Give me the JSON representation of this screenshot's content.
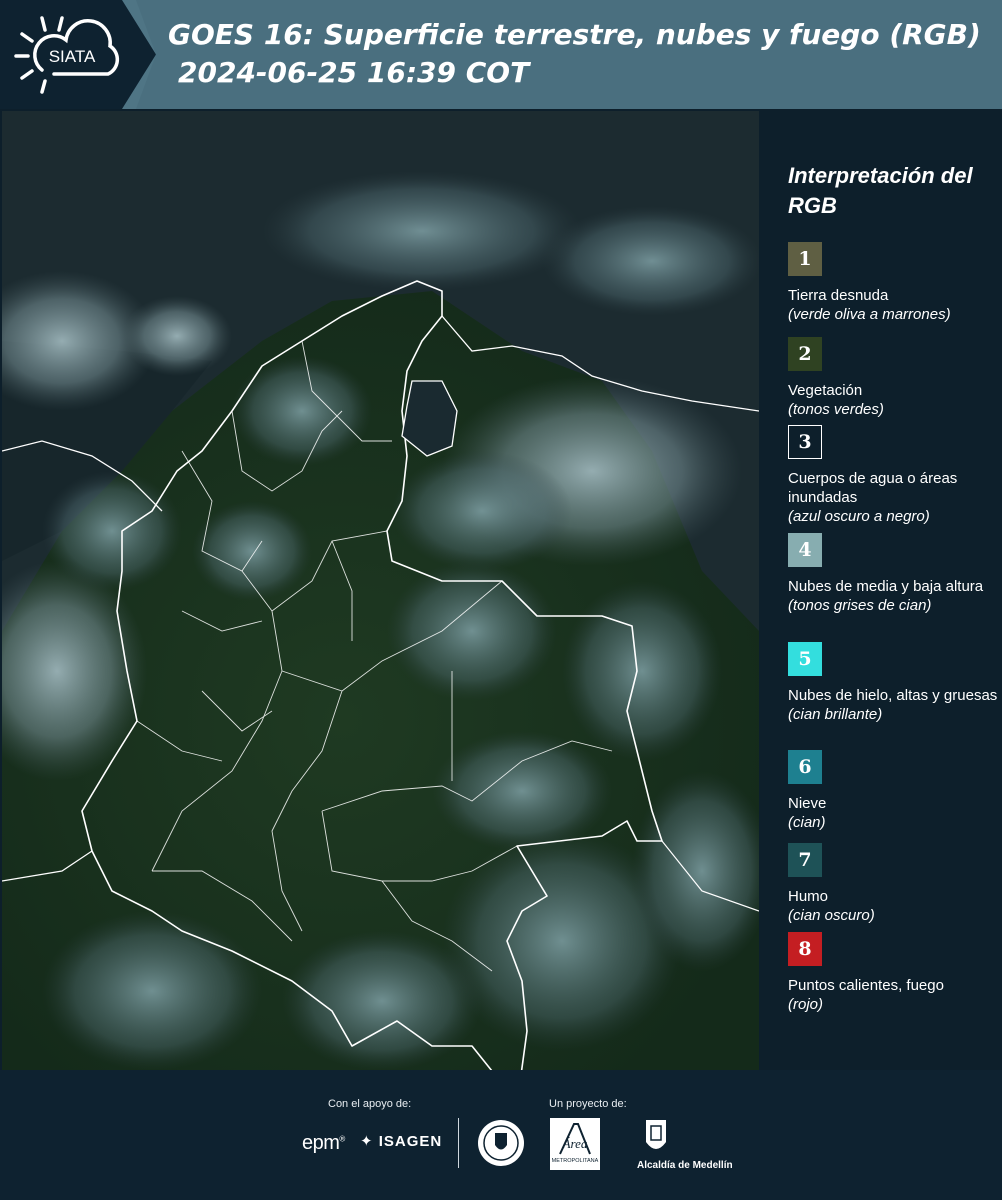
{
  "header": {
    "logo_text": "SIATA",
    "title_line1": "GOES 16: Superficie terrestre, nubes y fuego (RGB)",
    "title_line2": "2024-06-25 16:39 COT"
  },
  "legend": {
    "title": "Interpretación del RGB",
    "items": [
      {
        "number": "1",
        "color": "#5f5f43",
        "border": "#5f5f43",
        "label": "Tierra desnuda",
        "hint": "(verde oliva a marrones)"
      },
      {
        "number": "2",
        "color": "#2f4222",
        "border": "#2f4222",
        "label": "Vegetación",
        "hint": "(tonos verdes)"
      },
      {
        "number": "3",
        "color": "#0d1f2b",
        "border": "#ffffff",
        "label": "Cuerpos de agua o áreas inundadas",
        "hint": "(azul oscuro a negro)"
      },
      {
        "number": "4",
        "color": "#87adb0",
        "border": "#87adb0",
        "label": "Nubes de media y baja altura",
        "hint": "(tonos grises de cian)"
      },
      {
        "number": "5",
        "color": "#33dede",
        "border": "#33dede",
        "label": "Nubes de hielo, altas y gruesas",
        "hint": "(cian brillante)"
      },
      {
        "number": "6",
        "color": "#1e8090",
        "border": "#1e8090",
        "label": "Nieve",
        "hint": "(cian)"
      },
      {
        "number": "7",
        "color": "#1e5257",
        "border": "#1e5257",
        "label": "Humo",
        "hint": "(cian oscuro)"
      },
      {
        "number": "8",
        "color": "#c41e22",
        "border": "#c41e22",
        "label": "Puntos calientes, fuego",
        "hint": "(rojo)"
      }
    ]
  },
  "footer": {
    "support_label": "Con el apoyo de:",
    "project_label": "Un proyecto de:",
    "sponsor_1": "epm",
    "sponsor_2": "ISAGEN",
    "partner_1_text": "Área",
    "partner_1_subtext": "METROPOLITANA",
    "partner_2": "Alcaldía de Medellín"
  }
}
